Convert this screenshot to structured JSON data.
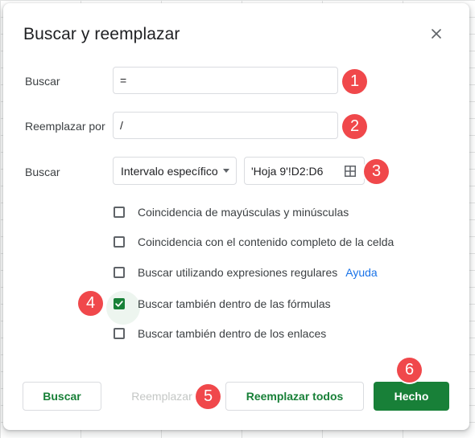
{
  "dialog": {
    "title": "Buscar y reemplazar",
    "close_icon": "close-icon"
  },
  "find": {
    "label": "Buscar",
    "value": "=",
    "badge": "1"
  },
  "replace": {
    "label": "Reemplazar por",
    "value": "/",
    "badge": "2"
  },
  "search_scope": {
    "label": "Buscar",
    "selected_option": "Intervalo específico",
    "range_value": "'Hoja 9'!D2:D6",
    "range_icon": "grid-select-icon",
    "badge": "3"
  },
  "options": [
    {
      "label": "Coincidencia de mayúsculas y minúsculas",
      "checked": false
    },
    {
      "label": "Coincidencia con el contenido completo de la celda",
      "checked": false
    },
    {
      "label": "Buscar utilizando expresiones regulares",
      "checked": false,
      "help_link": "Ayuda"
    },
    {
      "label": "Buscar también dentro de las fórmulas",
      "checked": true
    },
    {
      "label": "Buscar también dentro de los enlaces",
      "checked": false
    }
  ],
  "formulas_badge": "4",
  "buttons": {
    "find": "Buscar",
    "replace": "Reemplazar",
    "replace_badge": "5",
    "replace_all": "Reemplazar todos",
    "done": "Hecho",
    "done_badge": "6"
  },
  "colors": {
    "accent_green": "#188038",
    "badge_red": "#f0484b",
    "link_blue": "#1a73e8"
  }
}
